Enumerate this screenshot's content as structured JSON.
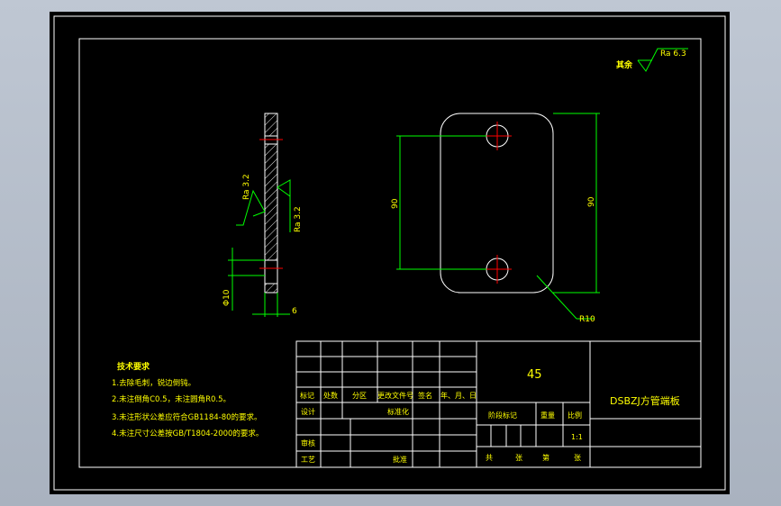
{
  "surface_finish_note": {
    "label": "其余",
    "value": "Ra 6.3"
  },
  "section_view": {
    "roughness_left": "Ra 3.2",
    "roughness_right": "Ra 3.2",
    "dim_hole_diameter": "Φ10",
    "dim_thickness": "6"
  },
  "plan_view": {
    "dim_hole_spacing": "90",
    "dim_outer_height": "90",
    "dim_corner_radius": "R10"
  },
  "technical_requirements": {
    "title": "技术要求",
    "items": [
      "1.去除毛刺，锐边倒钝。",
      "2.未注倒角C0.5，未注圆角R0.5。",
      "3.未注形状公差应符合GB1184-80的要求。",
      "4.未注尺寸公差按GB/T1804-2000的要求。"
    ]
  },
  "title_block": {
    "material": "45",
    "part_name": "DSBZJ方管端板",
    "revision_headers": [
      "标记",
      "处数",
      "分区",
      "更改文件号",
      "签名",
      "年、月、日"
    ],
    "design_label": "设计",
    "standardization_label": "标准化",
    "stage_mark_label": "阶段标记",
    "weight_label": "重量",
    "scale_label": "比例",
    "scale_value": "1:1",
    "review_label": "审核",
    "process_label": "工艺",
    "approve_label": "批准",
    "sheet_total_label": "共",
    "sheet_unit_label": "张",
    "sheet_index_label": "第",
    "sheet_unit_label_2": "张"
  },
  "colors": {
    "background": "#000000",
    "outline": "#ffffff",
    "dimension": "#00ff00",
    "centerline": "#ff0000",
    "text": "#ffff00"
  }
}
